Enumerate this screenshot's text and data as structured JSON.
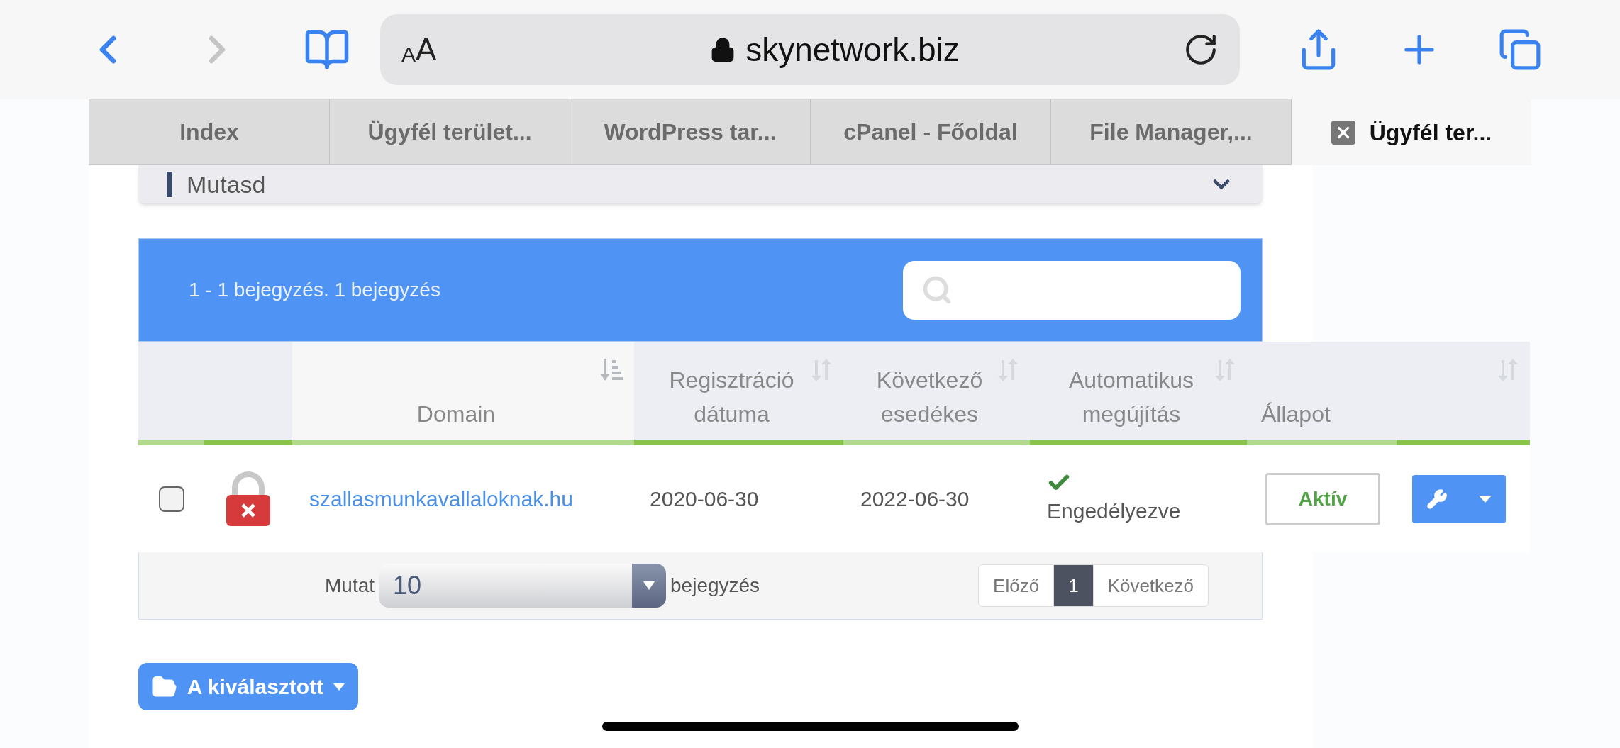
{
  "browser": {
    "back_disabled": false,
    "forward_disabled": true,
    "text_size": {
      "small": "A",
      "large": "A"
    },
    "address": "skynetwork.biz"
  },
  "tabs": [
    {
      "label": "Index",
      "selected": false
    },
    {
      "label": "Ügyfél terület...",
      "selected": false
    },
    {
      "label": "WordPress tar...",
      "selected": false
    },
    {
      "label": "cPanel - Főoldal",
      "selected": false
    },
    {
      "label": "File Manager,...",
      "selected": false
    },
    {
      "label": "Ügyfél ter...",
      "selected": true
    }
  ],
  "filter_panel": {
    "label": "Mutasd"
  },
  "table": {
    "summary": "1 - 1 bejegyzés. 1 bejegyzés",
    "columns": [
      {
        "sortable": false
      },
      {
        "sortable": false
      },
      {
        "label": "Domain",
        "sortable": true,
        "sorted": true
      },
      {
        "label": "Regisztráció\ndátuma",
        "sortable": true,
        "sorted": false
      },
      {
        "label": "Következő\nesedékes",
        "sortable": true,
        "sorted": false
      },
      {
        "label": "Automatikus\nmegújítás",
        "sortable": true,
        "sorted": false
      },
      {
        "label": "Állapot",
        "sortable": false
      },
      {
        "sortable": true,
        "sorted": false
      }
    ],
    "rows": [
      {
        "checked": false,
        "locked": true,
        "domain": "szallasmunkavallaloknak.hu",
        "registered": "2020-06-30",
        "next_due": "2022-06-30",
        "auto_renew": {
          "enabled": true,
          "label": "Engedélyezve"
        },
        "status": "Aktív"
      }
    ],
    "footer": {
      "show_label": "Mutat",
      "page_size": "10",
      "entries_label": "bejegyzés",
      "pages": [
        {
          "label": "Előző",
          "selected": false
        },
        {
          "label": "1",
          "selected": true
        },
        {
          "label": "Következő",
          "selected": false
        }
      ]
    }
  },
  "bulk_button": "A kiválasztott"
}
